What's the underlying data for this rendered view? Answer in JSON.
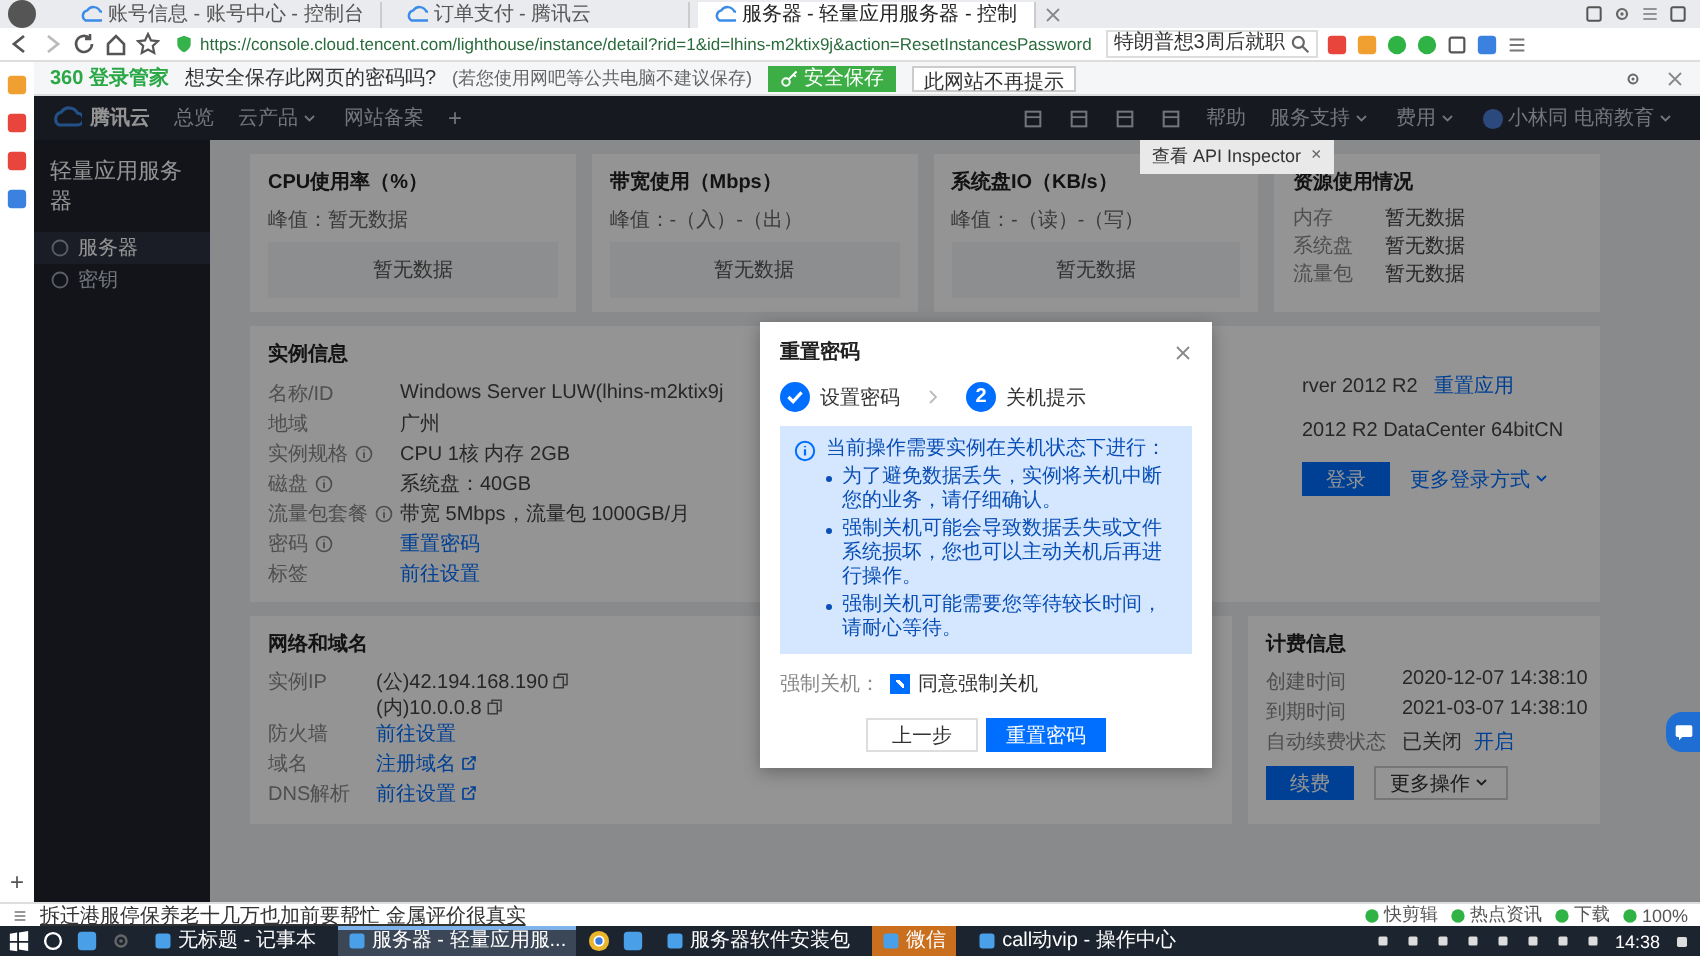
{
  "browser": {
    "tabs": [
      {
        "title": "账号信息 - 账号中心 - 控制台",
        "selected": false
      },
      {
        "title": "订单支付 - 腾讯云",
        "selected": false
      },
      {
        "title": "服务器 - 轻量应用服务器 - 控制",
        "selected": true
      }
    ],
    "url": "https://console.cloud.tencent.com/lighthouse/instance/detail?rid=1&id=lhins-m2ktix9j&action=ResetInstancesPassword",
    "search_value": "特朗普想3周后就职"
  },
  "password_bar": {
    "brand": "360 登录管家",
    "question": "想安全保存此网页的密码吗?",
    "note": "(若您使用网吧等公共电脑不建议保存)",
    "save_button": "安全保存",
    "never_button": "此网站不再提示"
  },
  "header": {
    "logo": "腾讯云",
    "nav": [
      {
        "label": "总览",
        "dropdown": false
      },
      {
        "label": "云产品",
        "dropdown": true
      },
      {
        "label": "网站备案",
        "dropdown": false
      }
    ],
    "add": "+",
    "right_nav": [
      {
        "label": "帮助",
        "dropdown": false
      },
      {
        "label": "服务支持",
        "dropdown": true
      },
      {
        "label": "费用",
        "dropdown": true
      },
      {
        "label": "小林同 电商教育",
        "dropdown": true
      }
    ]
  },
  "tooltip": {
    "label": "查看 API Inspector",
    "close": "×"
  },
  "sidebar": {
    "title": "轻量应用服务器",
    "items": [
      {
        "label": "服务器",
        "selected": true
      },
      {
        "label": "密钥",
        "selected": false
      }
    ]
  },
  "metric_cards": [
    {
      "title": "CPU使用率（%）",
      "peak": "峰值：暂无数据",
      "empty": "暂无数据"
    },
    {
      "title": "带宽使用（Mbps）",
      "peak": "峰值：-（入）-（出）",
      "empty": "暂无数据"
    },
    {
      "title": "系统盘IO（KB/s）",
      "peak": "峰值：-（读）-（写）",
      "empty": "暂无数据"
    }
  ],
  "resource_card": {
    "title": "资源使用情况",
    "rows": [
      {
        "label": "内存",
        "value": "暂无数据"
      },
      {
        "label": "系统盘",
        "value": "暂无数据"
      },
      {
        "label": "流量包",
        "value": "暂无数据"
      }
    ]
  },
  "instance": {
    "title": "实例信息",
    "rows": [
      {
        "label": "名称/ID",
        "info": false,
        "kind": "text",
        "value": "Windows Server LUW(lhins-m2ktix9j"
      },
      {
        "label": "地域",
        "info": false,
        "kind": "text",
        "value": "广州"
      },
      {
        "label": "实例规格",
        "info": true,
        "kind": "text",
        "value": "CPU 1核 内存 2GB"
      },
      {
        "label": "磁盘",
        "info": true,
        "kind": "text",
        "value": "系统盘：40GB"
      },
      {
        "label": "流量包套餐",
        "info": true,
        "kind": "text",
        "value": "带宽 5Mbps，流量包 1000GB/月"
      },
      {
        "label": "密码",
        "info": true,
        "kind": "link",
        "value": "重置密码"
      },
      {
        "label": "标签",
        "info": false,
        "kind": "link",
        "value": "前往设置"
      }
    ],
    "right_rows": [
      {
        "value": "rver 2012 R2",
        "link": "重置应用"
      },
      {
        "value": "2012 R2 DataCenter 64bitCN"
      }
    ],
    "actions": [
      {
        "label": "登录",
        "kind": "primary",
        "dropdown": false
      },
      {
        "label": "更多登录方式",
        "kind": "link",
        "dropdown": true
      }
    ]
  },
  "network": {
    "title": "网络和域名",
    "rows": [
      {
        "label": "实例IP",
        "kind": "text",
        "values": [
          "(公)42.194.168.190",
          "(内)10.0.0.8"
        ],
        "copy": true,
        "external": false
      },
      {
        "label": "防火墙",
        "kind": "link",
        "values": [
          "前往设置"
        ],
        "copy": false,
        "external": false
      },
      {
        "label": "域名",
        "kind": "link",
        "values": [
          "注册域名"
        ],
        "copy": false,
        "external": true
      },
      {
        "label": "DNS解析",
        "kind": "link",
        "values": [
          "前往设置"
        ],
        "copy": false,
        "external": true
      }
    ]
  },
  "billing": {
    "title": "计费信息",
    "rows": [
      {
        "label": "创建时间",
        "value": "2020-12-07 14:38:10"
      },
      {
        "label": "到期时间",
        "value": "2021-03-07 14:38:10"
      },
      {
        "label": "自动续费状态",
        "value": "已关闭",
        "link": "开启"
      }
    ],
    "actions": [
      {
        "label": "续费",
        "kind": "primary",
        "dropdown": false
      },
      {
        "label": "更多操作",
        "kind": "secondary",
        "dropdown": true
      }
    ]
  },
  "dialog": {
    "title": "重置密码",
    "steps": [
      {
        "label": "设置密码",
        "done": true
      },
      {
        "label": "关机提示",
        "done": false,
        "number": "2"
      }
    ],
    "info": {
      "heading": "当前操作需要实例在关机状态下进行：",
      "bullets": [
        "为了避免数据丢失，实例将关机中断您的业务，请仔细确认。",
        "强制关机可能会导致数据丢失或文件系统损坏，您也可以主动关机后再进行操作。",
        "强制关机可能需要您等待较长时间，请耐心等待。"
      ]
    },
    "force_label": "强制关机：",
    "agree": {
      "label": "同意强制关机",
      "checked": true
    },
    "buttons": [
      {
        "label": "上一步",
        "kind": "secondary"
      },
      {
        "label": "重置密码",
        "kind": "primary"
      }
    ]
  },
  "side_add": "+",
  "status_bar": {
    "headline": "拆迁港服停保养老十几万也加前要帮忙 金属评价很真实",
    "items": [
      "快剪辑",
      "热点资讯",
      "下载",
      "100%"
    ]
  },
  "taskbar": {
    "items": [
      {
        "kind": "pin"
      },
      {
        "kind": "pin"
      },
      {
        "kind": "pin"
      },
      {
        "kind": "app",
        "label": "无标题 - 记事本",
        "selected": false,
        "flash": false
      },
      {
        "kind": "app",
        "label": "服务器 - 轻量应用服...",
        "selected": true,
        "flash": false
      },
      {
        "kind": "pin"
      },
      {
        "kind": "pin"
      },
      {
        "kind": "app",
        "label": "服务器软件安装包",
        "selected": false,
        "flash": false
      },
      {
        "kind": "app",
        "label": "微信",
        "selected": false,
        "flash": true
      },
      {
        "kind": "app",
        "label": "call动vip - 操作中心",
        "selected": false,
        "flash": false
      }
    ],
    "time": "14:38"
  }
}
